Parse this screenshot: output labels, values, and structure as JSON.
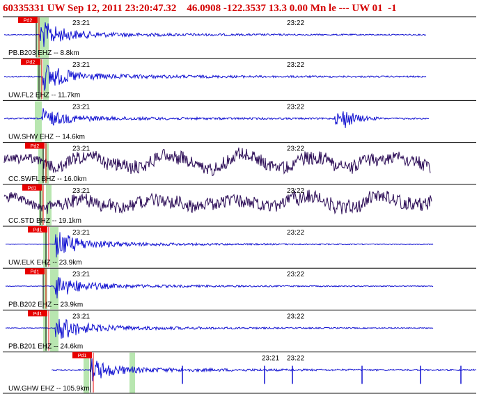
{
  "header": {
    "text": "60335331 UW Sep 12, 2011 23:20:47.32    46.0908 -122.3537 13.3 0.00 Mn le --- UW 01  -1"
  },
  "colors": {
    "blue_trace": "#1010d0",
    "purple_trace": "#2a0a55",
    "pick_box": "#e80000",
    "pick_line": "#000000",
    "highlight_band": "#b8e6b0",
    "separator": "#000000",
    "header_text": "#d40000"
  },
  "time_marks": [
    "23:21",
    "23:22"
  ],
  "traces": [
    {
      "label": "PB.B203 EHZ -- 8.8km",
      "pick_label": "Pd2",
      "color": "blue",
      "onset_amp": 1.0,
      "noise": 0.22,
      "late_event": false
    },
    {
      "label": "UW.FL2 EHZ -- 11.7km",
      "pick_label": "Pd2",
      "color": "blue",
      "onset_amp": 1.0,
      "noise": 0.3,
      "late_event": false
    },
    {
      "label": "UW.SHW EHZ -- 14.6km",
      "pick_label": "",
      "color": "blue",
      "onset_amp": 0.7,
      "noise": 0.3,
      "late_event": true
    },
    {
      "label": "CC.SWFL BHZ -- 16.0km",
      "pick_label": "Pd2",
      "color": "purple",
      "onset_amp": 0.9,
      "noise": 0.9,
      "late_event": false
    },
    {
      "label": "CC.STD BHZ -- 19.1km",
      "pick_label": "Pd1",
      "color": "purple",
      "onset_amp": 0.9,
      "noise": 0.9,
      "late_event": false
    },
    {
      "label": "UW.ELK EHZ -- 23.9km",
      "pick_label": "Pd1",
      "color": "blue",
      "onset_amp": 1.0,
      "noise": 0.12,
      "late_event": false
    },
    {
      "label": "PB.B202 EHZ -- 23.9km",
      "pick_label": "Pd1",
      "color": "blue",
      "onset_amp": 0.9,
      "noise": 0.15,
      "late_event": false
    },
    {
      "label": "PB.B201 EHZ -- 24.6km",
      "pick_label": "Pd1",
      "color": "blue",
      "onset_amp": 1.0,
      "noise": 0.18,
      "late_event": false
    },
    {
      "label": "UW.GHW EHZ -- 105.9km",
      "pick_label": "Pd1",
      "color": "blue",
      "onset_amp": 0.8,
      "noise": 0.3,
      "late_event": false
    }
  ]
}
